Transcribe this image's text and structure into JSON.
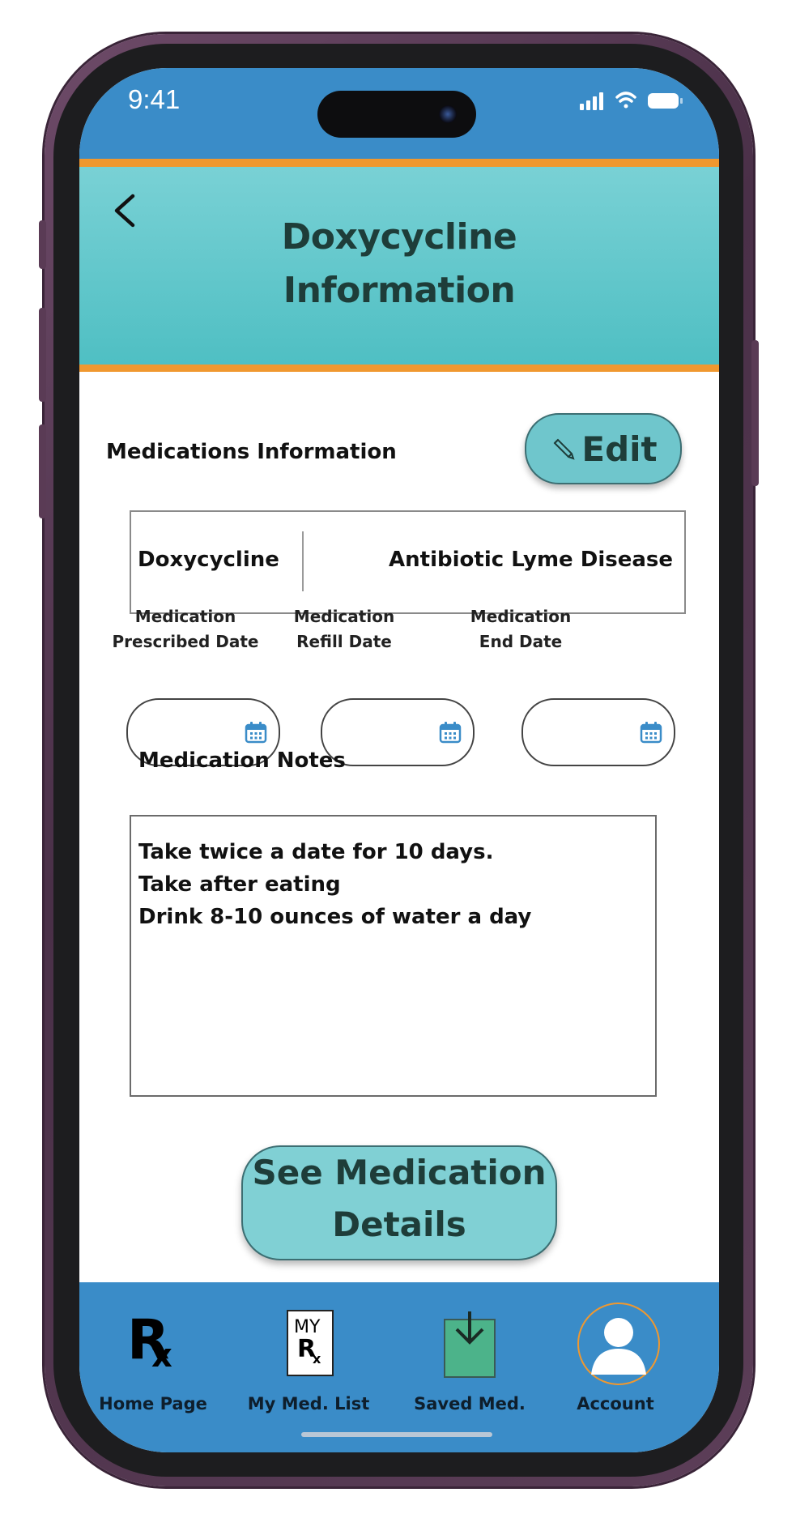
{
  "status_bar": {
    "time": "9:41"
  },
  "header": {
    "title_line1": "Doxycycline",
    "title_line2": "Information"
  },
  "section": {
    "label": "Medications Information",
    "edit_label": "Edit"
  },
  "medication": {
    "name": "Doxycycline",
    "type": "Antibiotic Lyme Disease"
  },
  "dates": [
    {
      "line1": "Medication",
      "line2": "Prescribed Date",
      "value": ""
    },
    {
      "line1": "Medication",
      "line2": "Refill Date",
      "value": ""
    },
    {
      "line1": "Medication",
      "line2": "End Date",
      "value": ""
    }
  ],
  "notes": {
    "label": "Medication Notes",
    "lines": [
      "Take twice a date for 10 days.",
      "Take after eating",
      "Drink 8-10 ounces of water a day"
    ]
  },
  "details_button": {
    "line1": "See Medication",
    "line2": "Details"
  },
  "nav": {
    "items": [
      {
        "label": "Home Page",
        "icon": "rx-icon"
      },
      {
        "label": "My Med. List",
        "icon": "my-rx-icon"
      },
      {
        "label": "Saved Med.",
        "icon": "download-icon"
      },
      {
        "label": "Account",
        "icon": "account-icon"
      }
    ]
  },
  "colors": {
    "status_blue": "#3a8cc8",
    "header_teal": "#5ec6ca",
    "accent_orange": "#f0982f",
    "button_teal": "#6fc6cc",
    "frame_purple": "#5c3e58"
  }
}
